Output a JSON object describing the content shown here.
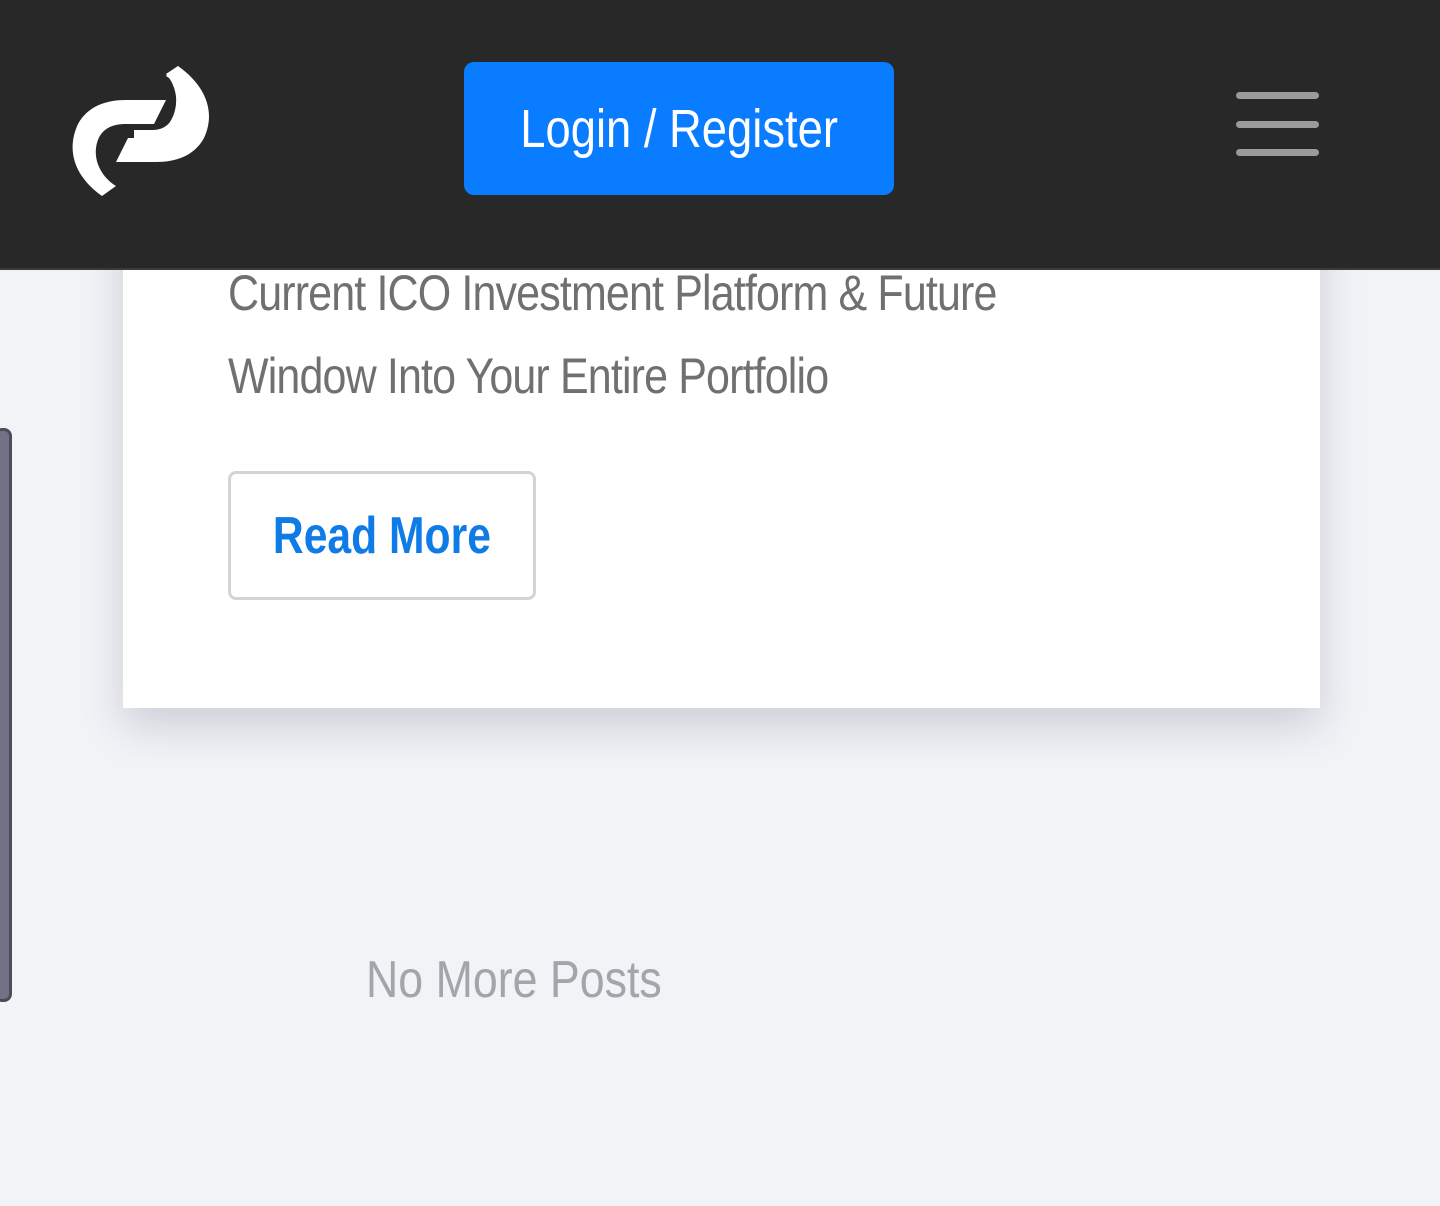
{
  "header": {
    "logo_name": "logo-icon",
    "login_label": "Login / Register",
    "menu_icon": "hamburger-menu-icon",
    "background_color": "#282828",
    "accent_color": "#0a7cff"
  },
  "post": {
    "excerpt_line1": "Current ICO Investment Platform & Future",
    "excerpt_line2": "Window Into Your Entire Portfolio",
    "read_more_label": "Read More"
  },
  "footer": {
    "status_text": "No More Posts"
  }
}
